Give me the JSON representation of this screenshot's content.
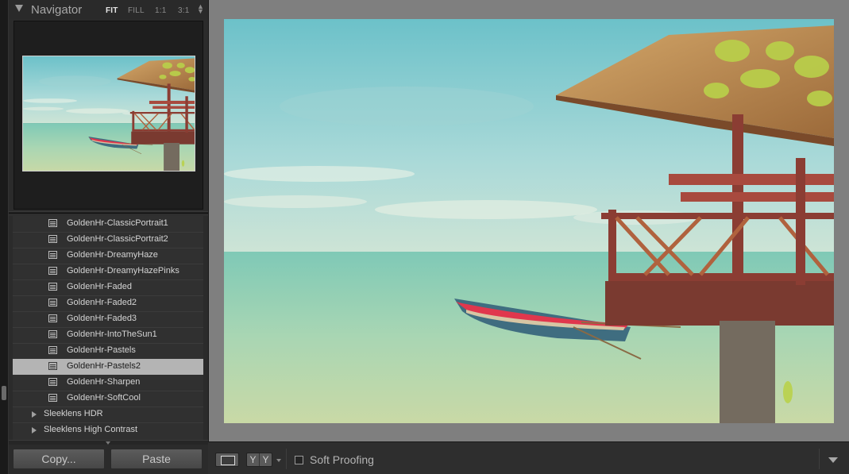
{
  "navigator": {
    "title": "Navigator",
    "zoom_options": [
      "FIT",
      "FILL",
      "1:1",
      "3:1"
    ],
    "active_zoom": "FIT"
  },
  "presets": {
    "items": [
      {
        "label": "GoldenHr-ClassicPortrait1",
        "selected": false
      },
      {
        "label": "GoldenHr-ClassicPortrait2",
        "selected": false
      },
      {
        "label": "GoldenHr-DreamyHaze",
        "selected": false
      },
      {
        "label": "GoldenHr-DreamyHazePinks",
        "selected": false
      },
      {
        "label": "GoldenHr-Faded",
        "selected": false
      },
      {
        "label": "GoldenHr-Faded2",
        "selected": false
      },
      {
        "label": "GoldenHr-Faded3",
        "selected": false
      },
      {
        "label": "GoldenHr-IntoTheSun1",
        "selected": false
      },
      {
        "label": "GoldenHr-Pastels",
        "selected": false
      },
      {
        "label": "GoldenHr-Pastels2",
        "selected": true
      },
      {
        "label": "GoldenHr-Sharpen",
        "selected": false
      },
      {
        "label": "GoldenHr-SoftCool",
        "selected": false
      }
    ],
    "folders": [
      {
        "label": "Sleeklens HDR"
      },
      {
        "label": "Sleeklens High Contrast"
      }
    ]
  },
  "buttons": {
    "copy": "Copy...",
    "paste": "Paste"
  },
  "toolbar": {
    "yy_left": "Y",
    "yy_right": "Y",
    "soft_proofing": "Soft Proofing",
    "soft_proofing_checked": false
  },
  "colors": {
    "selection": "#b4b4b4",
    "panel_bg": "#2b2b2b",
    "canvas_bg": "#7f7f7f"
  }
}
